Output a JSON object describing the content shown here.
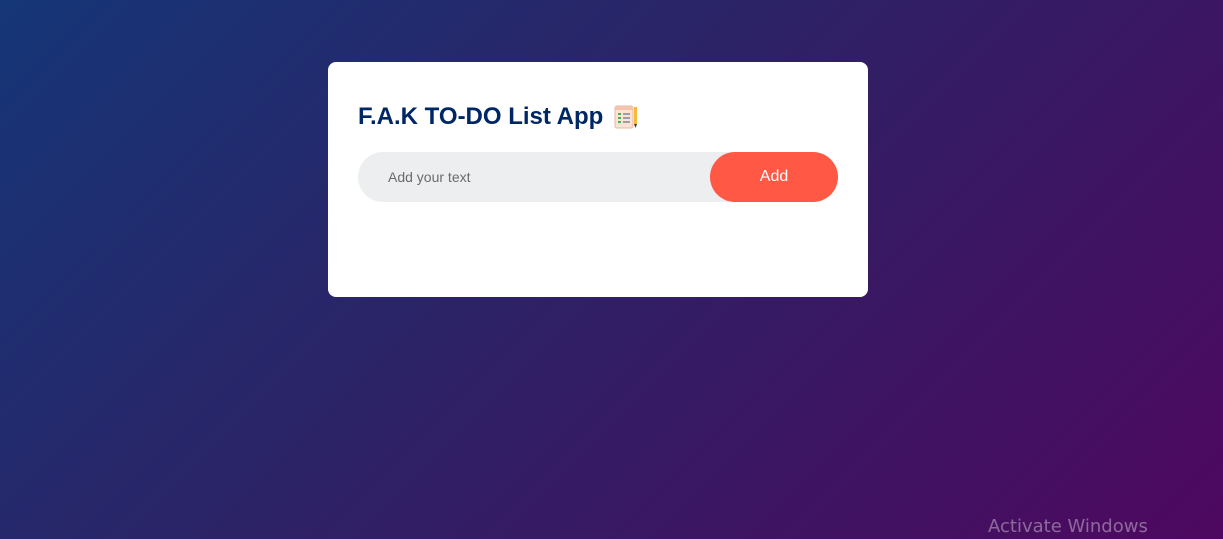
{
  "app": {
    "title": "F.A.K TO-DO List App",
    "title_icon": "checklist-notepad-icon"
  },
  "task_input": {
    "placeholder": "Add your text",
    "value": ""
  },
  "add_button": {
    "label": "Add"
  },
  "watermark": {
    "text": "Activate Windows"
  },
  "colors": {
    "background_start": "#153677",
    "background_end": "#4e085f",
    "title": "#002765",
    "accent": "#ff5945",
    "input_bg": "#edeef0",
    "card_bg": "#ffffff"
  }
}
